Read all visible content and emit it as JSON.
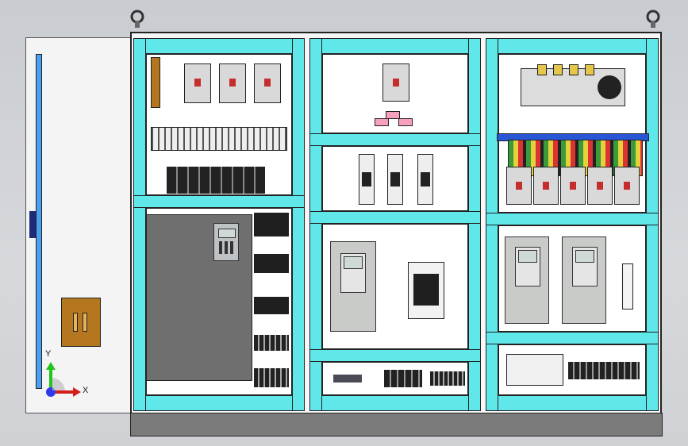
{
  "title": "",
  "axis": {
    "x_label": "X",
    "y_label": "Y"
  },
  "colors": {
    "cabinet": "#f7f7f7",
    "rail": "#5fe7ea",
    "base": "#7b7b7b",
    "vfd": "#c9cbc9",
    "knob": "#b4761f",
    "bus_blue": "#2956d6",
    "label_pink": "#f7a0bd",
    "axis_x": "#d31e1e",
    "axis_y": "#22c41e",
    "axis_z": "#2d3be8"
  },
  "icons": [
    "lifting-eye-icon",
    "door-handle-icon",
    "coordinate-triad-icon"
  ]
}
